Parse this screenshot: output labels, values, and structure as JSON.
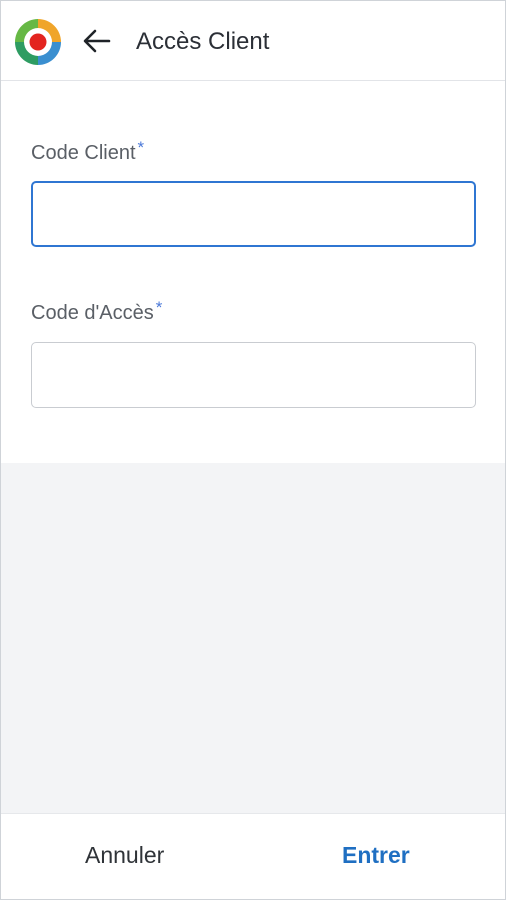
{
  "header": {
    "title": "Accès Client",
    "logo_icon": "app-logo-icon",
    "back_icon": "arrow-left-icon"
  },
  "form": {
    "code_client": {
      "label": "Code Client",
      "required_mark": "*",
      "value": "",
      "focused": true
    },
    "code_acces": {
      "label": "Code d'Accès",
      "required_mark": "*",
      "value": "",
      "focused": false
    }
  },
  "footer": {
    "cancel_label": "Annuler",
    "enter_label": "Entrer"
  },
  "colors": {
    "accent": "#2f76d2",
    "enter_text": "#1f6fc2",
    "required_mark": "#4a78d8",
    "background": "#f3f4f6"
  }
}
